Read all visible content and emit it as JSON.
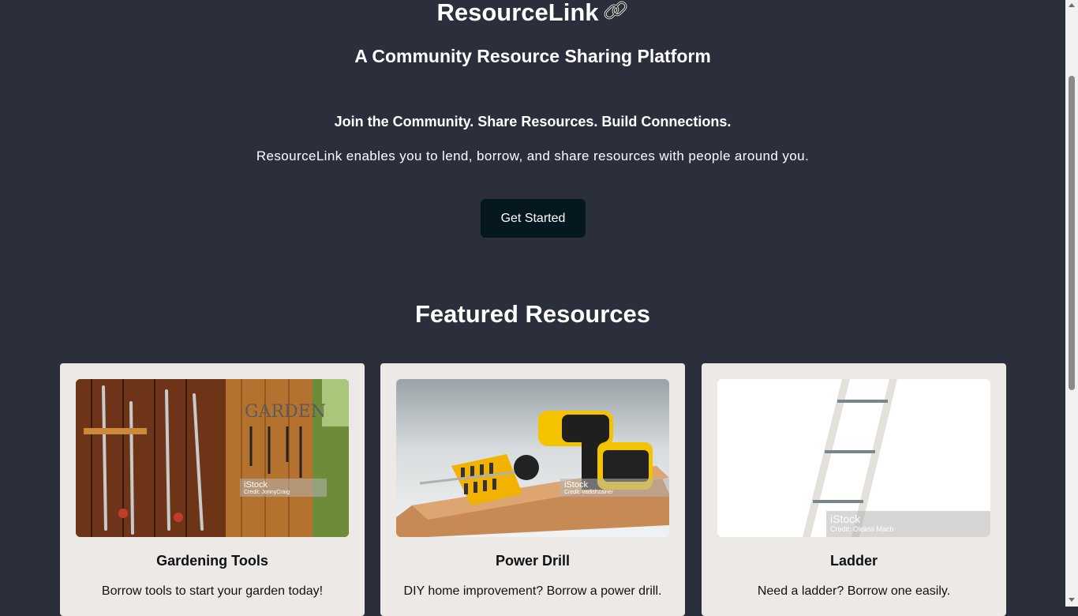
{
  "header": {
    "brand": "ResourceLink",
    "brand_icon": "link-icon",
    "tagline": "A Community Resource Sharing Platform"
  },
  "hero": {
    "headline": "Join the Community. Share Resources. Build Connections.",
    "description": "ResourceLink enables you to lend, borrow, and share resources with people around you.",
    "cta_label": "Get Started"
  },
  "featured": {
    "title": "Featured Resources",
    "cards": [
      {
        "title": "Gardening Tools",
        "text": "Borrow tools to start your garden today!",
        "image": "gardening-tools-photo",
        "watermark": "iStock",
        "credit": "Credit: JonnyCraig"
      },
      {
        "title": "Power Drill",
        "text": "DIY home improvement? Borrow a power drill.",
        "image": "power-drill-photo",
        "watermark": "iStock",
        "credit": "Credit: vadishzainer"
      },
      {
        "title": "Ladder",
        "text": "Need a ladder? Borrow one easily.",
        "image": "ladder-photo",
        "watermark": "iStock",
        "credit": "Credit: Oleksii Mach"
      }
    ]
  },
  "colors": {
    "background": "#2b2f3c",
    "card_background": "#ece9e6",
    "button": "#06181f"
  }
}
